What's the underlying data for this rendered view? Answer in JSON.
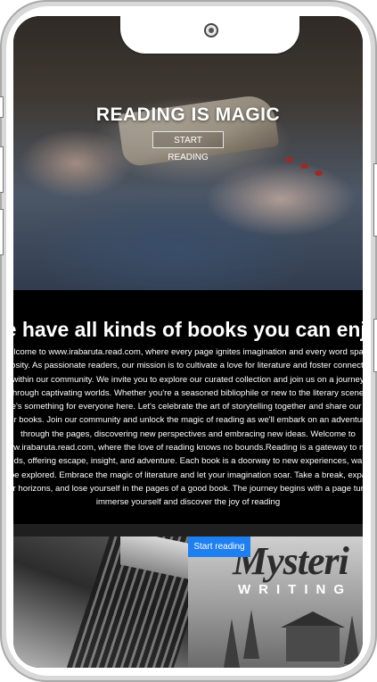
{
  "hero": {
    "title": "READING IS MAGIC",
    "button_label": "START READING"
  },
  "about": {
    "heading": "We have all kinds of books you can enjoy",
    "paragraph": "Welcome to www.irabaruta.read.com, where every page ignites imagination and every word sparks curiosity. As passionate readers, our mission is to cultivate a love for literature and foster connections within our community. We invite you to explore our curated collection and join us on a journey through captivating worlds. Whether you're a seasoned bibliophile or new to the literary scene, there's something for everyone here. Let's celebrate the art of storytelling together and share our love for books. Join our community and unlock the magic of reading as we'll embark on an adventure through the pages, discovering new perspectives and embracing new ideas. Welcome to www.irabaruta.read.com, where the love of reading knows no bounds.Reading is a gateway to new worlds, offering escape, insight, and adventure. Each book is a doorway to new experiences, waiting to be explored. Embrace the magic of literature and let your imagination soar. Take a break, expand your horizons, and lose yourself in the pages of a good book. The journey begins with a page turn—immerse yourself and discover the joy of reading"
  },
  "cards": {
    "right_tag": "Start reading",
    "right_title": "Mysteri",
    "right_subtitle": "WRITING"
  },
  "colors": {
    "accent": "#1e7ff0",
    "background": "#000000",
    "text": "#ffffff"
  }
}
